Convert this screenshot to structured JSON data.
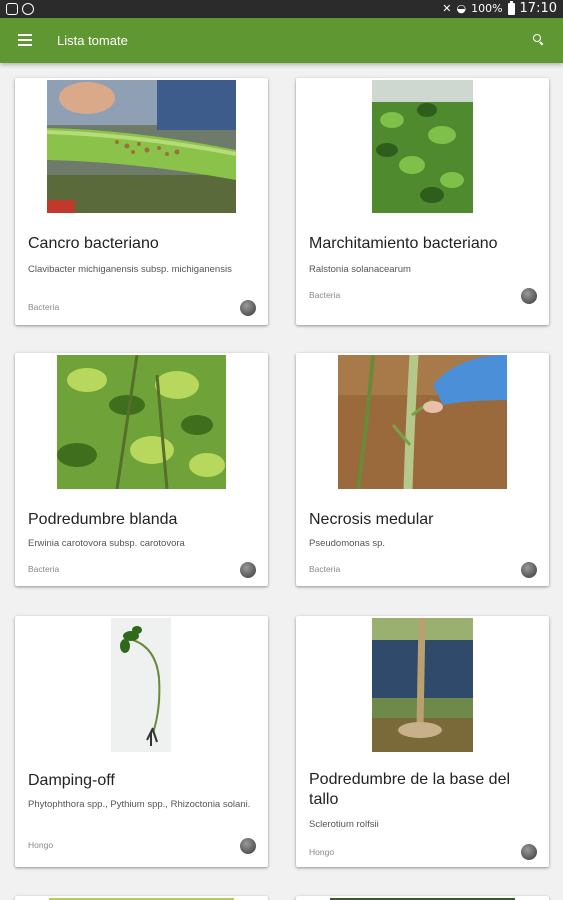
{
  "status_bar": {
    "battery": "100%",
    "time": "17:10",
    "icons": [
      "image-icon",
      "chat-icon",
      "mute-icon",
      "wifi-icon",
      "battery-icon"
    ]
  },
  "app_bar": {
    "title": "Lista tomate",
    "menu_icon": "menu-icon",
    "search_icon": "search-icon",
    "color": "#5f9832"
  },
  "cards": [
    {
      "name": "Cancro bacteriano",
      "scientific": "Clavibacter michiganensis subsp. michiganensis",
      "category": "Bacteria",
      "icon": "tomato-icon"
    },
    {
      "name": "Marchitamiento bacteriano",
      "scientific": "Ralstonia solanacearum",
      "category": "Bacteria",
      "icon": "tomato-icon"
    },
    {
      "name": "Podredumbre blanda",
      "scientific": "Erwinia carotovora subsp. carotovora",
      "category": "Bacteria",
      "icon": "tomato-icon"
    },
    {
      "name": "Necrosis medular",
      "scientific": "Pseudomonas sp.",
      "category": "Bacteria",
      "icon": "tomato-icon"
    },
    {
      "name": "Damping-off",
      "scientific": "Phytophthora spp., Pythium spp., Rhizoctonia solani.",
      "category": "Hongo",
      "icon": "tomato-icon"
    },
    {
      "name": "Podredumbre de la base del tallo",
      "scientific": "Sclerotium rolfsii",
      "category": "Hongo",
      "icon": "tomato-icon"
    }
  ]
}
